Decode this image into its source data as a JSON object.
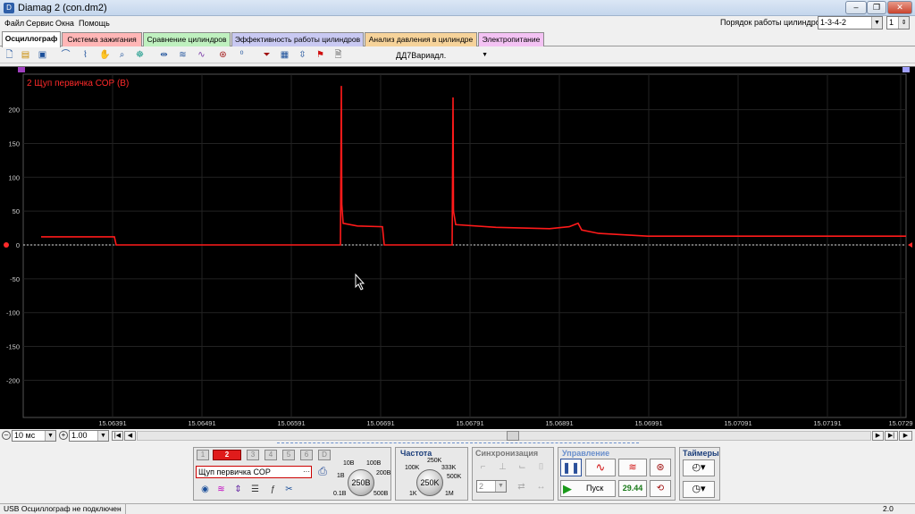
{
  "window": {
    "title": "Diamag 2 (con.dm2)",
    "app_icon": "app-icon",
    "min": "–",
    "max": "❐",
    "close": "✕"
  },
  "menu": [
    "Файл",
    "Сервис",
    "Окна",
    "Помощь"
  ],
  "cylinder_order": {
    "label": "Порядок работы цилиндров",
    "value": "1-3-4-2",
    "spin_value": "1"
  },
  "tabs": [
    {
      "label": "Осциллограф",
      "color": "#ffffff"
    },
    {
      "label": "Система зажигания",
      "color": "#ffb6b6"
    },
    {
      "label": "Сравнение цилиндров",
      "color": "#bff0bf"
    },
    {
      "label": "Эффективность работы цилиндров",
      "color": "#c9c9f2"
    },
    {
      "label": "Анализ давления в цилиндре",
      "color": "#f6d39a"
    },
    {
      "label": "Электропитание",
      "color": "#f3c2f3"
    }
  ],
  "toolbar": {
    "channel_combo": "ДД7Вариадл.",
    "icons": [
      "new-file-icon",
      "open-folder-icon",
      "save-icon",
      "probe-icon",
      "trigger-icon",
      "hand-icon",
      "zoom-icon",
      "marker-icon",
      "expand-icon",
      "waves-icon",
      "compress-icon",
      "auto-icon",
      "zero-icon",
      "filter-icon",
      "table-icon",
      "split-icon",
      "flag-icon",
      "page-icon"
    ]
  },
  "chart_data": {
    "type": "line",
    "title": "2 Щуп первичка СОР (В)",
    "ylim": [
      -250,
      250
    ],
    "yticks": [
      200,
      150,
      100,
      50,
      0,
      -50,
      -100,
      -150,
      -200
    ],
    "xticks": [
      "15.06391",
      "15.06491",
      "15.06591",
      "15.06691",
      "15.06791",
      "15.06891",
      "15.06991",
      "15.07091",
      "15.07191",
      "15.0729"
    ],
    "xlim": [
      15.06311,
      15.0729
    ],
    "series": [
      {
        "color": "#ff1a1a",
        "points": [
          [
            15.06311,
            12
          ],
          [
            15.06393,
            12
          ],
          [
            15.06395,
            0
          ],
          [
            15.06646,
            0
          ],
          [
            15.06647,
            235
          ],
          [
            15.066475,
            60
          ],
          [
            15.06649,
            32
          ],
          [
            15.06665,
            28
          ],
          [
            15.06693,
            27
          ],
          [
            15.06695,
            0
          ],
          [
            15.06771,
            0
          ],
          [
            15.06772,
            218
          ],
          [
            15.067725,
            50
          ],
          [
            15.06775,
            30
          ],
          [
            15.0682,
            26
          ],
          [
            15.0688,
            24
          ],
          [
            15.06902,
            27
          ],
          [
            15.06912,
            32
          ],
          [
            15.06916,
            22
          ],
          [
            15.06935,
            17
          ],
          [
            15.0699,
            13
          ],
          [
            15.071,
            13
          ],
          [
            15.0729,
            13
          ]
        ]
      }
    ],
    "cursor_value": "0",
    "grid": true
  },
  "bottom": {
    "timebase": "10 мс",
    "zoom": "1.00",
    "channels": [
      "1",
      "2",
      "3",
      "4",
      "5",
      "6",
      "D"
    ],
    "probe_name": "Щуп первичка СОР",
    "voltage_knob": {
      "value": "250В",
      "labels": [
        "10В",
        "100В",
        "1В",
        "200В",
        "0.1В",
        "500В"
      ]
    },
    "freq": {
      "heading": "Частота",
      "value": "250K",
      "labels": [
        "250K",
        "100K",
        "333K",
        "500K",
        "1K",
        "1M"
      ]
    },
    "sync": {
      "heading": "Синхронизация",
      "channel": "2"
    },
    "control": {
      "heading": "Управление",
      "start": "Пуск",
      "fps": "29.44"
    },
    "timers": {
      "heading": "Таймеры"
    }
  },
  "status": {
    "left": "USB Осциллограф не подключен",
    "right": "2.0"
  }
}
